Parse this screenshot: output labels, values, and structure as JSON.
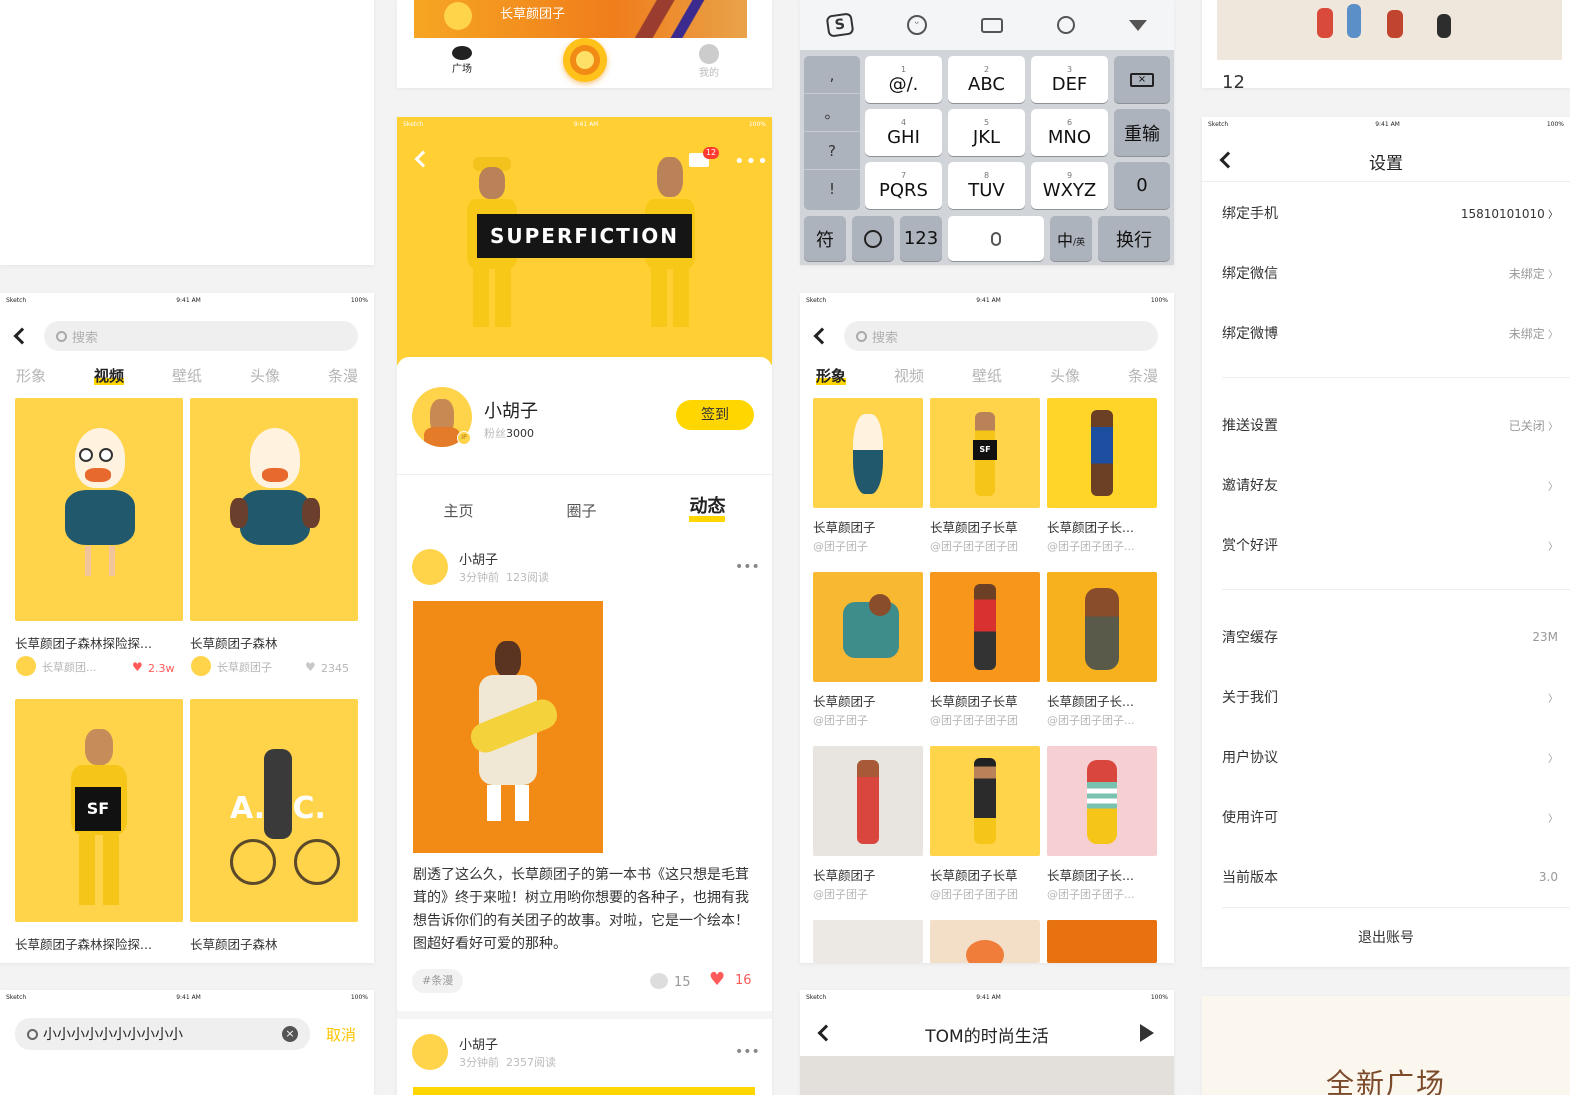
{
  "status": {
    "carrier": "Sketch",
    "time": "9:41 AM",
    "battery": "100%"
  },
  "top_nav": {
    "left_label": "广场",
    "right_label": "我的",
    "banner_text": "长草颜团子"
  },
  "keyboard": {
    "toolbar_icons": [
      "sogou-icon",
      "emoji-icon",
      "keyboard-icon",
      "search-icon",
      "collapse-icon"
    ],
    "punct": [
      ",",
      "。",
      "?",
      "!"
    ],
    "keys": [
      {
        "n": "1",
        "l": "@/."
      },
      {
        "n": "2",
        "l": "ABC"
      },
      {
        "n": "3",
        "l": "DEF"
      },
      {
        "n": "4",
        "l": "GHI"
      },
      {
        "n": "5",
        "l": "JKL"
      },
      {
        "n": "6",
        "l": "MNO"
      },
      {
        "n": "7",
        "l": "PQRS"
      },
      {
        "n": "8",
        "l": "TUV"
      },
      {
        "n": "9",
        "l": "WXYZ"
      }
    ],
    "reenter": "重输",
    "zero": "0",
    "sym": "符",
    "num": "123",
    "lang": "中/英",
    "lang_main": "中",
    "lang_sub": "/英",
    "enter": "换行"
  },
  "settings": {
    "title": "设置",
    "rows": [
      {
        "label": "绑定手机",
        "value": "15810101010"
      },
      {
        "label": "绑定微信",
        "value": "未绑定"
      },
      {
        "label": "绑定微博",
        "value": "未绑定"
      },
      {
        "label": "推送设置",
        "value": "已关闭"
      },
      {
        "label": "邀请好友",
        "value": ""
      },
      {
        "label": "赏个好评",
        "value": ""
      },
      {
        "label": "清空缓存",
        "value": "23M"
      },
      {
        "label": "关于我们",
        "value": ""
      },
      {
        "label": "用户协议",
        "value": ""
      },
      {
        "label": "使用许可",
        "value": ""
      },
      {
        "label": "当前版本",
        "value": "3.0"
      }
    ],
    "logout": "退出账号"
  },
  "video_page": {
    "search_placeholder": "搜索",
    "tabs": [
      "形象",
      "视频",
      "壁纸",
      "头像",
      "条漫"
    ],
    "active_tab": "视频",
    "items": [
      {
        "title": "长草颜团子森林探险探...",
        "author": "长草颜团...",
        "likes": "2.3w"
      },
      {
        "title": "长草颜团子森林",
        "author": "长草颜团子",
        "likes": "2345"
      },
      {
        "title": "长草颜团子森林探险探..."
      },
      {
        "title": "长草颜团子森林"
      }
    ],
    "sf_text": "SF",
    "atc_text": "A.T.C."
  },
  "profile": {
    "banner_text": "SUPERFICTION",
    "badge": "12",
    "name": "小胡子",
    "fans_label": "粉丝",
    "fans": "3000",
    "checkin": "签到",
    "tabs": [
      "主页",
      "圈子",
      "动态"
    ],
    "post": {
      "author": "小胡子",
      "time": "3分钟前",
      "reads": "123阅读",
      "text": "剧透了这么久，长草颜团子的第一本书《这只想是毛茸茸的》终于来啦！树立用哟你想要的各种子，也拥有我想告诉你们的有关团子的故事。对啦，它是一个绘本！图超好看好可爱的那种。",
      "tag": "#条漫",
      "comments": "15",
      "likes": "16"
    },
    "post2": {
      "author": "小胡子",
      "time": "3分钟前",
      "reads": "2357阅读"
    }
  },
  "figure_page": {
    "search_placeholder": "搜索",
    "tabs": [
      "形象",
      "视频",
      "壁纸",
      "头像",
      "条漫"
    ],
    "active_tab": "形象",
    "items": [
      {
        "title": "长草颜团子",
        "sub": "@团子团子"
      },
      {
        "title": "长草颜团子长草",
        "sub": "@团子团子团子团"
      },
      {
        "title": "长草颜团子长...",
        "sub": "@团子团子团子..."
      },
      {
        "title": "长草颜团子",
        "sub": "@团子团子"
      },
      {
        "title": "长草颜团子长草",
        "sub": "@团子团子团子团"
      },
      {
        "title": "长草颜团子长...",
        "sub": "@团子团子团子..."
      },
      {
        "title": "长草颜团子",
        "sub": "@团子团子"
      },
      {
        "title": "长草颜团子长草",
        "sub": "@团子团子团子团"
      },
      {
        "title": "长草颜团子长...",
        "sub": "@团子团子团子..."
      }
    ],
    "sf_text": "SF"
  },
  "search_page": {
    "query": "小小小小小小小小小小",
    "cancel": "取消"
  },
  "tom_page": {
    "title": "TOM的时尚生活"
  },
  "promo": {
    "title": "全新广场"
  },
  "partial_number": "12",
  "colors": {
    "accent": "#ffd600",
    "brand_yellow": "#ffd34a",
    "orange": "#f28a16",
    "like_red": "#ff5a5a",
    "keyboard_bg": "#d1d4d9"
  }
}
